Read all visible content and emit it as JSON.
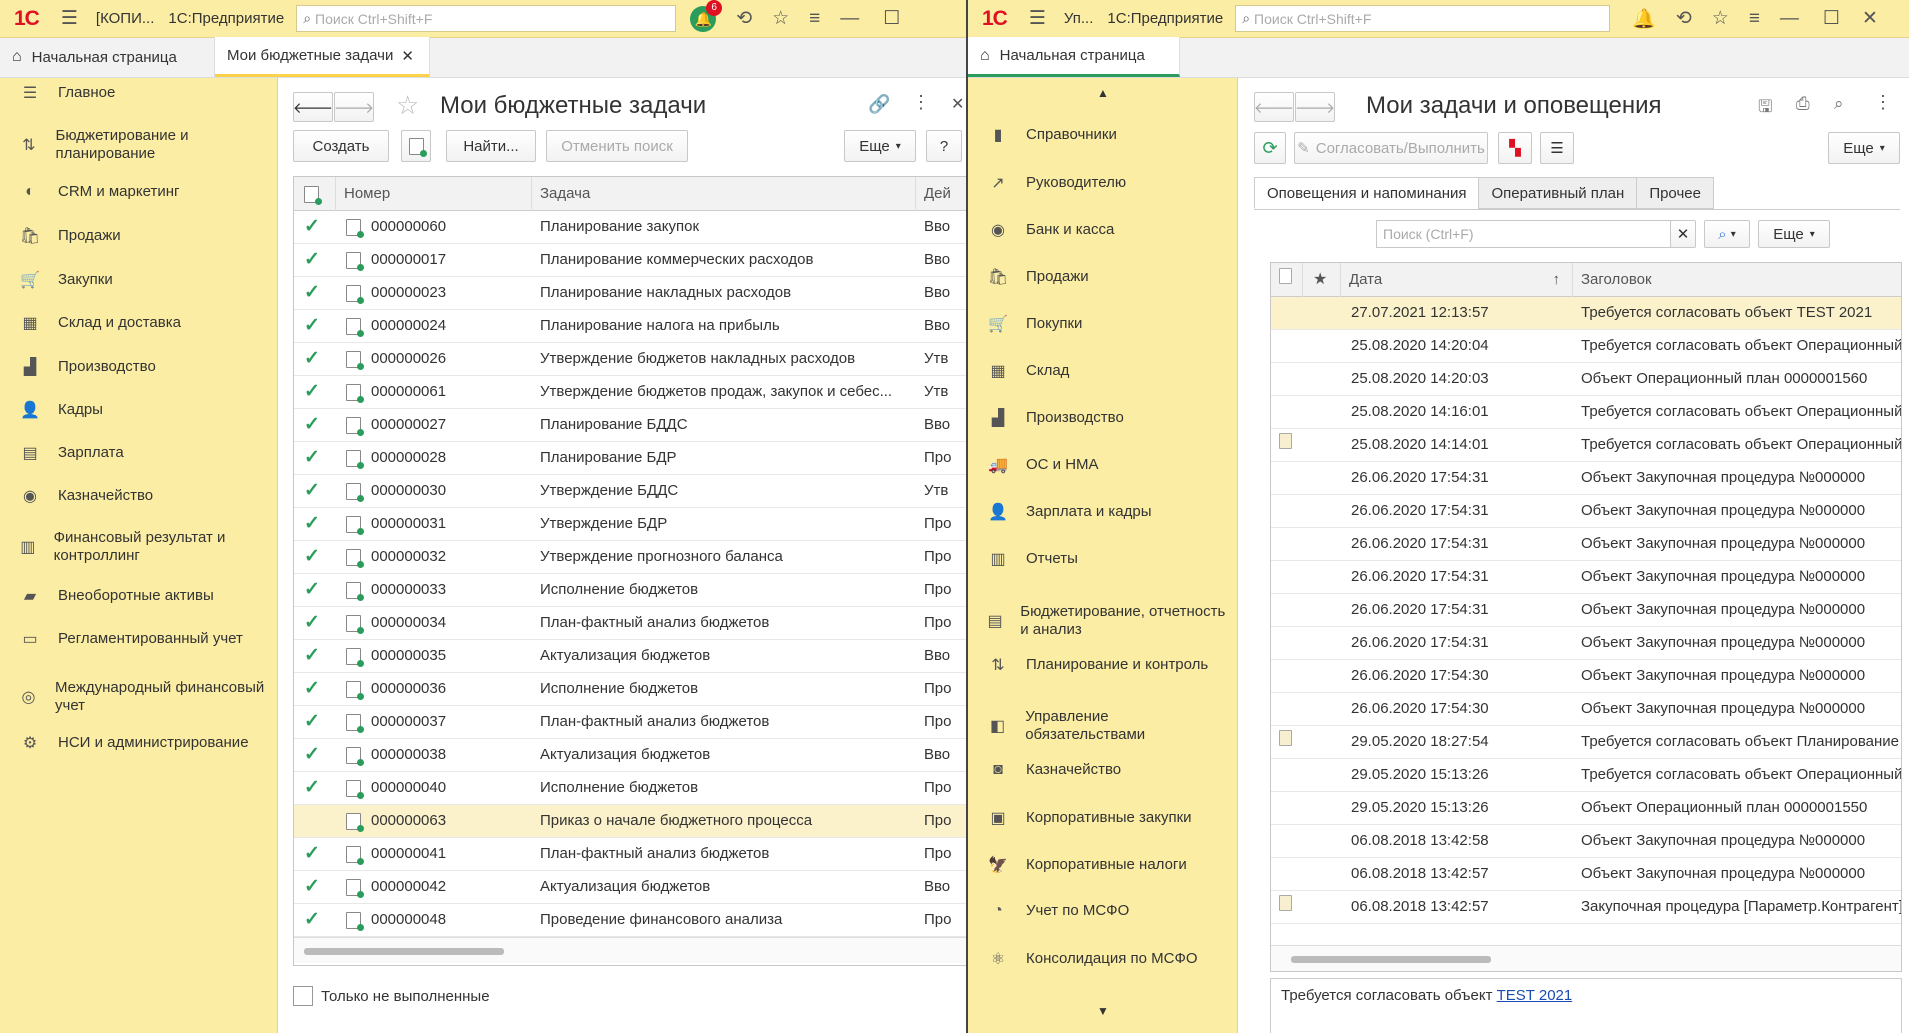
{
  "left": {
    "window_title": "[КОПИ...",
    "app_name": "1С:Предприятие",
    "search_placeholder": "Поиск Ctrl+Shift+F",
    "notif_count": "6",
    "tabs": {
      "home": "Начальная страница",
      "budget": "Мои бюджетные задачи"
    },
    "nav": [
      "Главное",
      "Бюджетирование и планирование",
      "CRM и маркетинг",
      "Продажи",
      "Закупки",
      "Склад и доставка",
      "Производство",
      "Кадры",
      "Зарплата",
      "Казначейство",
      "Финансовый результат и контроллинг",
      "Внеоборотные активы",
      "Регламентированный учет",
      "Международный финансовый учет",
      "НСИ и администрирование"
    ],
    "form_title": "Мои бюджетные задачи",
    "buttons": {
      "create": "Создать",
      "find": "Найти...",
      "cancel_search": "Отменить поиск",
      "more": "Еще",
      "help": "?"
    },
    "columns": {
      "number": "Номер",
      "task": "Задача",
      "action": "Дей"
    },
    "rows": [
      {
        "done": true,
        "number": "000000060",
        "task": "Планирование закупок",
        "action": "Вво"
      },
      {
        "done": true,
        "number": "000000017",
        "task": "Планирование коммерческих расходов",
        "action": "Вво"
      },
      {
        "done": true,
        "number": "000000023",
        "task": "Планирование накладных расходов",
        "action": "Вво"
      },
      {
        "done": true,
        "number": "000000024",
        "task": "Планирование налога на прибыль",
        "action": "Вво"
      },
      {
        "done": true,
        "number": "000000026",
        "task": "Утверждение бюджетов накладных расходов",
        "action": "Утв"
      },
      {
        "done": true,
        "number": "000000061",
        "task": "Утверждение бюджетов продаж, закупок и себес...",
        "action": "Утв"
      },
      {
        "done": true,
        "number": "000000027",
        "task": "Планирование БДДС",
        "action": "Вво"
      },
      {
        "done": true,
        "number": "000000028",
        "task": "Планирование БДР",
        "action": "Про"
      },
      {
        "done": true,
        "number": "000000030",
        "task": "Утверждение БДДС",
        "action": "Утв"
      },
      {
        "done": true,
        "number": "000000031",
        "task": "Утверждение БДР",
        "action": "Про"
      },
      {
        "done": true,
        "number": "000000032",
        "task": "Утверждение прогнозного баланса",
        "action": "Про"
      },
      {
        "done": true,
        "number": "000000033",
        "task": "Исполнение бюджетов",
        "action": "Про"
      },
      {
        "done": true,
        "number": "000000034",
        "task": "План-фактный анализ бюджетов",
        "action": "Про"
      },
      {
        "done": true,
        "number": "000000035",
        "task": "Актуализация бюджетов",
        "action": "Вво"
      },
      {
        "done": true,
        "number": "000000036",
        "task": "Исполнение бюджетов",
        "action": "Про"
      },
      {
        "done": true,
        "number": "000000037",
        "task": "План-фактный анализ бюджетов",
        "action": "Про"
      },
      {
        "done": true,
        "number": "000000038",
        "task": "Актуализация бюджетов",
        "action": "Вво"
      },
      {
        "done": true,
        "number": "000000040",
        "task": "Исполнение бюджетов",
        "action": "Про"
      },
      {
        "done": false,
        "number": "000000063",
        "task": "Приказ о начале бюджетного процесса",
        "action": "Про"
      },
      {
        "done": true,
        "number": "000000041",
        "task": "План-фактный анализ бюджетов",
        "action": "Про"
      },
      {
        "done": true,
        "number": "000000042",
        "task": "Актуализация бюджетов",
        "action": "Вво"
      },
      {
        "done": true,
        "number": "000000048",
        "task": "Проведение финансового анализа",
        "action": "Про"
      }
    ],
    "only_unfinished": "Только не выполненные"
  },
  "right": {
    "window_title": "Уп...",
    "app_name": "1С:Предприятие",
    "search_placeholder": "Поиск Ctrl+Shift+F",
    "tab_home": "Начальная страница",
    "nav": [
      "Справочники",
      "Руководителю",
      "Банк и касса",
      "Продажи",
      "Покупки",
      "Склад",
      "Производство",
      "ОС и НМА",
      "Зарплата и кадры",
      "Отчеты",
      "Бюджетирование, отчетность и анализ",
      "Планирование и контроль",
      "Управление обязательствами",
      "Казначейство",
      "Корпоративные закупки",
      "Корпоративные налоги",
      "Учет по МСФО",
      "Консолидация по МСФО"
    ],
    "form_title": "Мои задачи и оповещения",
    "buttons": {
      "approve": "Согласовать/Выполнить",
      "more": "Еще",
      "more2": "Еще"
    },
    "subtabs": [
      "Оповещения и напоминания",
      "Оперативный план",
      "Прочее"
    ],
    "search_placeholder2": "Поиск (Ctrl+F)",
    "columns": {
      "date": "Дата",
      "title": "Заголовок"
    },
    "rows": [
      {
        "clip": false,
        "date": "27.07.2021 12:13:57",
        "title": "Требуется согласовать объект TEST 2021"
      },
      {
        "clip": false,
        "date": "25.08.2020 14:20:04",
        "title": "Требуется согласовать объект Операционный"
      },
      {
        "clip": false,
        "date": "25.08.2020 14:20:03",
        "title": "Объект Операционный план 0000001560"
      },
      {
        "clip": false,
        "date": "25.08.2020 14:16:01",
        "title": "Требуется согласовать объект Операционный"
      },
      {
        "clip": true,
        "date": "25.08.2020 14:14:01",
        "title": "Требуется согласовать объект Операционный"
      },
      {
        "clip": false,
        "date": "26.06.2020 17:54:31",
        "title": "Объект Закупочная процедура №000000"
      },
      {
        "clip": false,
        "date": "26.06.2020 17:54:31",
        "title": "Объект Закупочная процедура №000000"
      },
      {
        "clip": false,
        "date": "26.06.2020 17:54:31",
        "title": "Объект Закупочная процедура №000000"
      },
      {
        "clip": false,
        "date": "26.06.2020 17:54:31",
        "title": "Объект Закупочная процедура №000000"
      },
      {
        "clip": false,
        "date": "26.06.2020 17:54:31",
        "title": "Объект Закупочная процедура №000000"
      },
      {
        "clip": false,
        "date": "26.06.2020 17:54:31",
        "title": "Объект Закупочная процедура №000000"
      },
      {
        "clip": false,
        "date": "26.06.2020 17:54:30",
        "title": "Объект Закупочная процедура №000000"
      },
      {
        "clip": false,
        "date": "26.06.2020 17:54:30",
        "title": "Объект Закупочная процедура №000000"
      },
      {
        "clip": true,
        "date": "29.05.2020 18:27:54",
        "title": "Требуется согласовать объект Планирование"
      },
      {
        "clip": false,
        "date": "29.05.2020 15:13:26",
        "title": "Требуется согласовать объект Операционный"
      },
      {
        "clip": false,
        "date": "29.05.2020 15:13:26",
        "title": "Объект Операционный план 0000001550"
      },
      {
        "clip": false,
        "date": "06.08.2018 13:42:58",
        "title": "Объект Закупочная процедура №000000"
      },
      {
        "clip": false,
        "date": "06.08.2018 13:42:57",
        "title": "Объект Закупочная процедура №000000"
      },
      {
        "clip": true,
        "date": "06.08.2018 13:42:57",
        "title": "Закупочная процедура [Параметр.Контрагент]"
      }
    ],
    "preview_text": "Требуется согласовать объект",
    "preview_link": "TEST 2021"
  }
}
